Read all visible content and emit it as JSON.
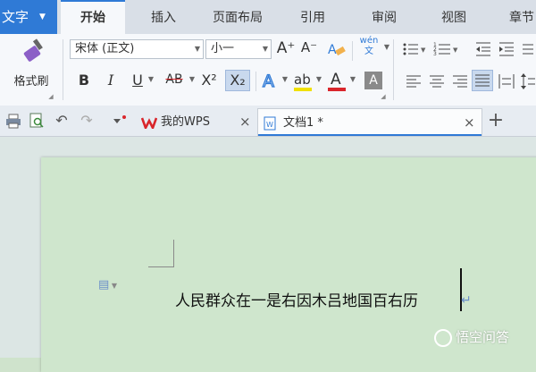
{
  "app": {
    "menu_label": "文字",
    "menu_caret": "▼"
  },
  "ribbon_tabs": [
    "开始",
    "插入",
    "页面布局",
    "引用",
    "审阅",
    "视图",
    "章节"
  ],
  "active_tab": "开始",
  "toolbar": {
    "format_painter_label": "格式刷",
    "font_name": "宋体 (正文)",
    "font_size": "小一",
    "grow_font": "A⁺",
    "shrink_font": "A⁻",
    "bold": "B",
    "italic": "I",
    "underline": "U",
    "strikethrough": "AB",
    "superscript": "X²",
    "subscript": "X₂",
    "phonetic_label": "wén\n文",
    "font_color_letter": "A",
    "highlight_letter": "ab",
    "colors": {
      "font_color": "#d9262c",
      "highlight": "#f0e000",
      "accent": "#2f7ad6"
    }
  },
  "doc_tabs": [
    {
      "label": "我的WPS",
      "close": "×"
    },
    {
      "label": "文档1 *",
      "close": "×"
    }
  ],
  "new_tab": "+",
  "document": {
    "text": "人民群众在一是右因木吕地国百右历",
    "paragraph_mark": "↵"
  },
  "watermark": "悟空问答"
}
